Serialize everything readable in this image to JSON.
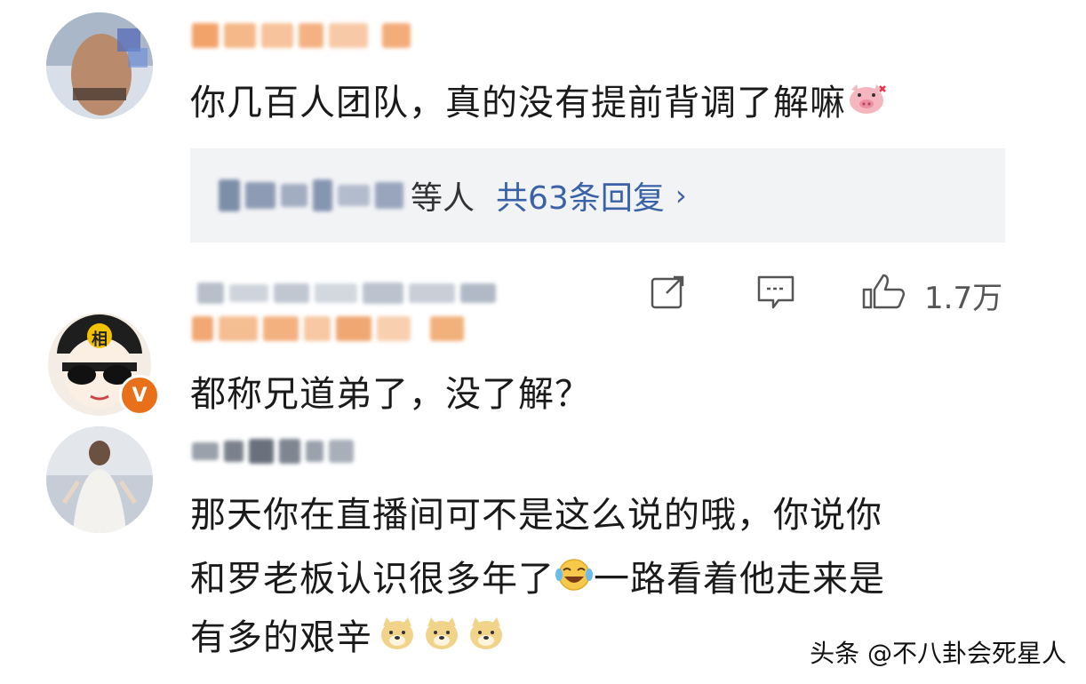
{
  "comment1": {
    "text": "你几百人团队，真的没有提前背调了解嘛",
    "emoji": "pig-face-emoji",
    "replies": {
      "suffix": "等人",
      "link": "共63条回复",
      "chevron": "›"
    },
    "actions": {
      "share_icon": "share-icon",
      "comment_icon": "comment-icon",
      "like_icon": "thumbs-up-icon",
      "like_count": "1.7万"
    }
  },
  "comment2": {
    "text": "都称兄道弟了，没了解？",
    "avatar_badge": "相",
    "verified_badge": "V"
  },
  "comment3": {
    "line1": "那天你在直播间可不是这么说的哦，你说你",
    "line2a": "和罗老板认识很多年了",
    "line2b": "一路看着他走来是",
    "line3": "有多的艰辛"
  },
  "watermark": "头条 @不八卦会死星人",
  "colors": {
    "link": "#3a62a8",
    "reply_bg": "#f2f3f5",
    "text": "#1a1a1a",
    "verified": "#e8701a"
  }
}
